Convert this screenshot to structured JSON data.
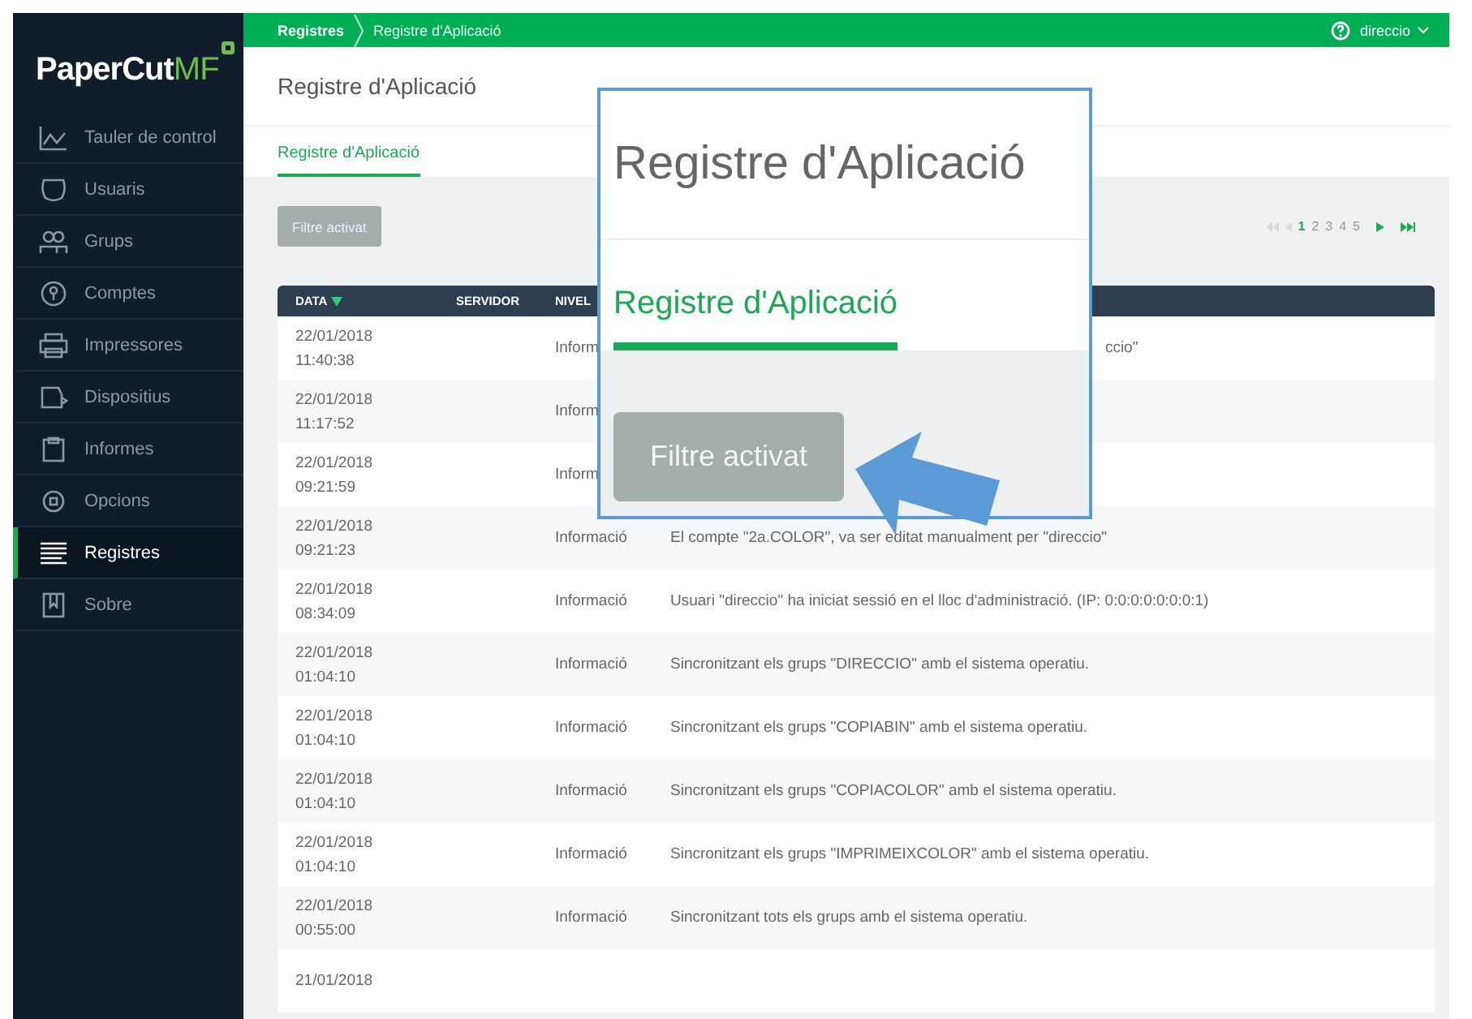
{
  "top_bar": {
    "breadcrumb": [
      {
        "label": "Registres"
      },
      {
        "label": "Registre d'Aplicació"
      }
    ],
    "user": "direccio"
  },
  "logo": {
    "text": "PaperCut",
    "suffix": "MF"
  },
  "sidebar": {
    "items": [
      {
        "label": "Tauler de control",
        "selected": false
      },
      {
        "label": "Usuaris",
        "selected": false
      },
      {
        "label": "Grups",
        "selected": false
      },
      {
        "label": "Comptes",
        "selected": false
      },
      {
        "label": "Impressores",
        "selected": false
      },
      {
        "label": "Dispositius",
        "selected": false
      },
      {
        "label": "Informes",
        "selected": false
      },
      {
        "label": "Opcions",
        "selected": false
      },
      {
        "label": "Registres",
        "selected": true
      },
      {
        "label": "Sobre",
        "selected": false
      }
    ]
  },
  "header": {
    "title": "Registre d'Aplicació"
  },
  "tabs": [
    {
      "label": "Registre d'Aplicació",
      "selected": true
    }
  ],
  "filter_button": {
    "label": "Filtre activat"
  },
  "pagination": {
    "pages": [
      {
        "label": "1",
        "selected": true
      },
      {
        "label": "2",
        "selected": false
      },
      {
        "label": "3",
        "selected": false
      },
      {
        "label": "4",
        "selected": false
      },
      {
        "label": "5",
        "selected": false
      }
    ]
  },
  "table": {
    "columns": [
      {
        "label": "DATA",
        "sorted": true
      },
      {
        "label": "SERVIDOR",
        "sorted": false
      },
      {
        "label": "NIVEL",
        "sorted": false
      }
    ],
    "rows": [
      {
        "kind": "covered",
        "date": "22/01/2018",
        "time": "11:40:38",
        "level": "Inform",
        "message": "ccio\""
      },
      {
        "kind": "covered",
        "date": "22/01/2018",
        "time": "11:17:52",
        "level": "Inform"
      },
      {
        "kind": "covered",
        "date": "22/01/2018",
        "time": "09:21:59",
        "level": "Inform"
      },
      {
        "kind": "full",
        "date": "22/01/2018",
        "time": "09:21:23",
        "level": "Informació",
        "message": "El compte \"2a.COLOR\", va ser editat manualment per \"direccio\""
      },
      {
        "kind": "full",
        "date": "22/01/2018",
        "time": "08:34:09",
        "level": "Informació",
        "message": "Usuari \"direccio\" ha iniciat sessió en el lloc d'administració. (IP: 0:0:0:0:0:0:0:1)"
      },
      {
        "kind": "full",
        "date": "22/01/2018",
        "time": "01:04:10",
        "level": "Informació",
        "message": "Sincronitzant els grups \"DIRECCIO\" amb el sistema operatiu."
      },
      {
        "kind": "full",
        "date": "22/01/2018",
        "time": "01:04:10",
        "level": "Informació",
        "message": "Sincronitzant els grups \"COPIABIN\" amb el sistema operatiu."
      },
      {
        "kind": "full",
        "date": "22/01/2018",
        "time": "01:04:10",
        "level": "Informació",
        "message": "Sincronitzant els grups \"COPIACOLOR\" amb el sistema operatiu."
      },
      {
        "kind": "full",
        "date": "22/01/2018",
        "time": "01:04:10",
        "level": "Informació",
        "message": "Sincronitzant els grups \"IMPRIMEIXCOLOR\" amb el sistema operatiu."
      },
      {
        "kind": "full",
        "date": "22/01/2018",
        "time": "00:55:00",
        "level": "Informació",
        "message": "Sincronitzant tots els grups amb el sistema operatiu."
      },
      {
        "kind": "full",
        "date": "21/01/2018"
      }
    ]
  },
  "callout": {
    "title": "Registre d'Aplicació",
    "tab": {
      "label": "Registre d'Aplicació",
      "selected": true
    },
    "button": "Filtre activat"
  }
}
